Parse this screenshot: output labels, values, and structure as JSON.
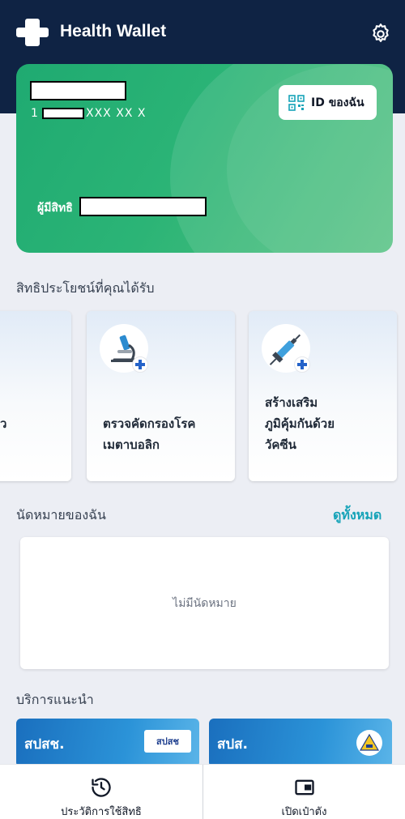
{
  "header": {
    "title": "Health Wallet",
    "settings_icon": "gear-icon",
    "background": "#0f2344"
  },
  "card": {
    "number_prefix": "1",
    "number_mask": "XXX XX X",
    "id_button_label": "ID ของฉัน",
    "holder_label": "ผู้มีสิทธิ",
    "gradient_start": "#1faa71",
    "gradient_end": "#52c07f"
  },
  "benefits": {
    "title": "สิทธิประโยชน์ที่คุณได้รับ",
    "partial_label": "ว",
    "items": [
      {
        "label": "ตรวจคัดกรองโรค\nเมตาบอลิก",
        "icon": "microscope-icon"
      },
      {
        "label": "สร้างเสริม\nภูมิคุ้มกันด้วย\nวัคซีน",
        "icon": "syringe-icon"
      }
    ]
  },
  "appointments": {
    "title": "นัดหมายของฉัน",
    "see_all": "ดูทั้งหมด",
    "empty_text": "ไม่มีนัดหมาย"
  },
  "services": {
    "title": "บริการแนะนำ",
    "items": [
      {
        "title": "สปสช.",
        "logo_text": "สปสช"
      },
      {
        "title": "สปส.",
        "logo_text": ""
      }
    ]
  },
  "bottom_nav": {
    "history_label": "ประวัติการใช้สิทธิ",
    "wallet_label": "เปิดเป๋าตัง"
  },
  "accent": "#16a3b8"
}
